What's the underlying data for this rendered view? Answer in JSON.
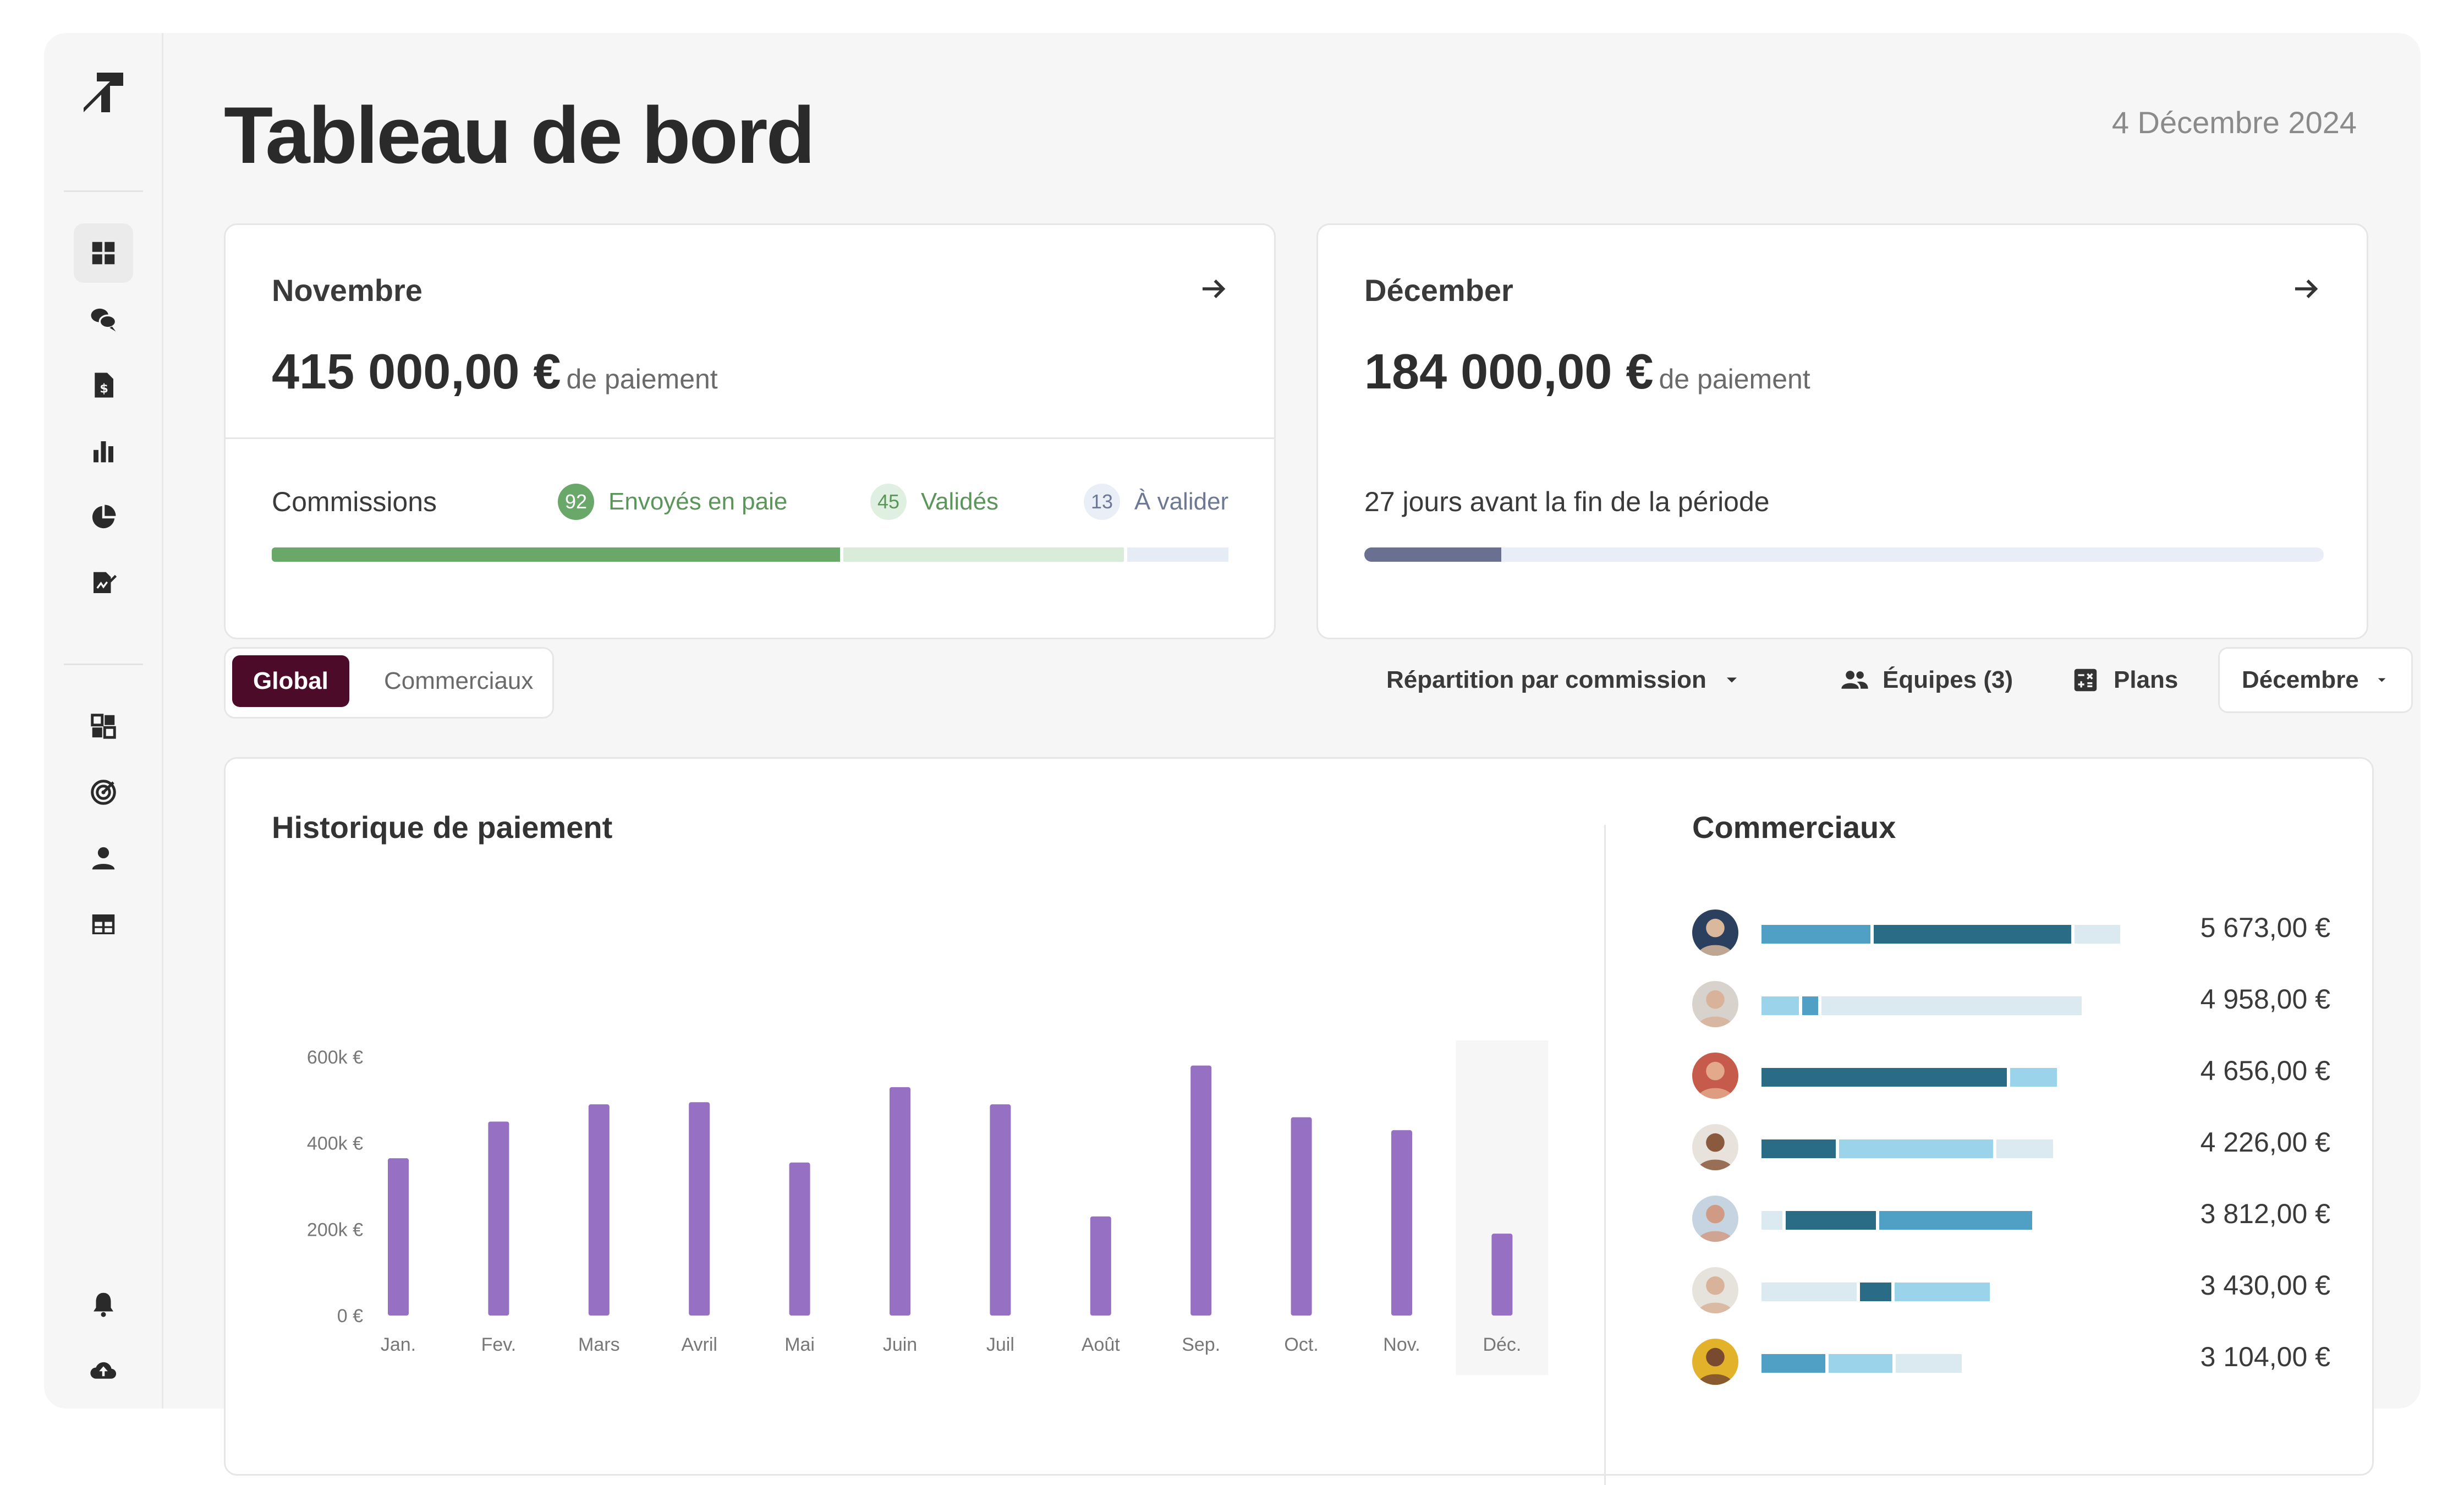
{
  "sidebar": {
    "logo": "brand-logo",
    "items_top": [
      "dashboard-icon",
      "chat-icon",
      "invoice-icon",
      "bar-chart-icon",
      "pie-chart-icon",
      "sign-document-icon"
    ],
    "items_mid": [
      "widgets-icon",
      "target-icon",
      "user-icon",
      "table-icon"
    ],
    "items_bottom": [
      "bell-icon",
      "cloud-upload-icon"
    ]
  },
  "header": {
    "title": "Tableau de bord",
    "date": "4 Décembre 2024"
  },
  "card_nov": {
    "month": "Novembre",
    "amount": "415 000,00 €",
    "amount_suffix": "de paiement",
    "commissions_label": "Commissions",
    "legend": [
      {
        "count": "92",
        "label": "Envoyés en paie",
        "color": "#6aa86a",
        "bg": "#6aa86a",
        "fg": "#ffffff"
      },
      {
        "count": "45",
        "label": "Validés",
        "color": "#6aa86a",
        "bg": "#e0f0e0",
        "fg": "#5a965a"
      },
      {
        "count": "13",
        "label": "À valider",
        "color": "#6c7894",
        "bg": "#e9eef7",
        "fg": "#6c7894"
      }
    ],
    "progress": [
      0.5921,
      0.2928,
      0.1053
    ]
  },
  "card_dec": {
    "month": "Décember",
    "amount": "184 000,00 €",
    "amount_suffix": "de paiement",
    "period_text": "27 jours avant la fin de la période",
    "period_progress": 0.143
  },
  "tabs": {
    "global": "Global",
    "commerciaux": "Commerciaux"
  },
  "filters": {
    "repartition": "Répartition par commission",
    "equipes": "Équipes (3)",
    "plans": "Plans",
    "month": "Décembre"
  },
  "payment_history": {
    "title": "Historique de paiement"
  },
  "chart_data": {
    "type": "bar",
    "title": "Historique de paiement",
    "categories": [
      "Jan.",
      "Fev.",
      "Mars",
      "Avril",
      "Mai",
      "Juin",
      "Juil",
      "Août",
      "Sep.",
      "Oct.",
      "Nov.",
      "Déc."
    ],
    "values": [
      365000,
      450000,
      490000,
      495000,
      355000,
      530000,
      490000,
      230000,
      580000,
      460000,
      430000,
      190000
    ],
    "yticks": [
      "0 €",
      "200k €",
      "400k €",
      "600k €"
    ],
    "ylim": [
      0,
      600000
    ],
    "highlight_index": 11,
    "bar_color": "#9670c2",
    "grid": false
  },
  "salesmen": {
    "title": "Commerciaux",
    "rows": [
      {
        "amount": "5 673,00 €",
        "segments": [
          0.31,
          0.56,
          0.13
        ],
        "scale": 1.0,
        "avatar_bg": "#2b3f5e",
        "avatar_skin": "#d9b89c"
      },
      {
        "amount": "4 958,00 €",
        "segments": [
          0.12,
          0.05,
          0.83
        ],
        "scale": 0.89,
        "avatar_bg": "#d8d2cc",
        "avatar_skin": "#d8b39a"
      },
      {
        "amount": "4 656,00 €",
        "segments": [
          0.84,
          0.16
        ],
        "scale": 0.83,
        "avatar_bg": "#c65b4b",
        "avatar_skin": "#e2a98b"
      },
      {
        "amount": "4 226,00 €",
        "segments": [
          0.26,
          0.54,
          0.2
        ],
        "scale": 0.81,
        "avatar_bg": "#e7e2dc",
        "avatar_skin": "#8a5a3e"
      },
      {
        "amount": "3 812,00 €",
        "segments": [
          0.08,
          0.34,
          0.58
        ],
        "scale": 0.75,
        "avatar_bg": "#c5d4e0",
        "avatar_skin": "#d09b84"
      },
      {
        "amount": "3 430,00 €",
        "segments": [
          0.43,
          0.14,
          0.43
        ],
        "scale": 0.63,
        "avatar_bg": "#e6e2dc",
        "avatar_skin": "#d8b39a"
      },
      {
        "amount": "3 104,00 €",
        "segments": [
          0.33,
          0.33,
          0.34
        ],
        "scale": 0.55,
        "avatar_bg": "#e3b22b",
        "avatar_skin": "#7a4a30"
      }
    ],
    "colors": [
      "#4fa0c4",
      "#2a6b86",
      "#9bd3ea",
      "#dbe9f1"
    ]
  }
}
